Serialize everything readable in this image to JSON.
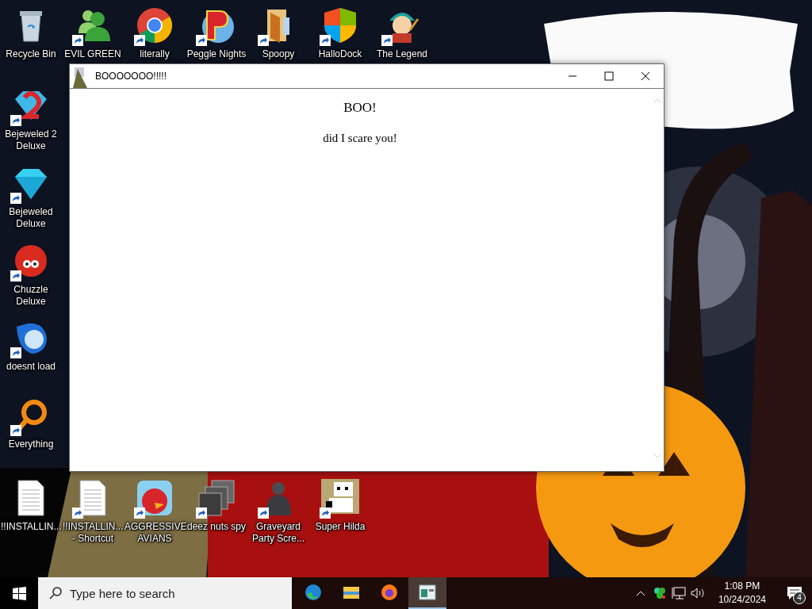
{
  "desktop": {
    "top_row": [
      {
        "label": "Recycle Bin",
        "kind": "trash",
        "shortcut": false
      },
      {
        "label": "EVIL GREEN",
        "kind": "people",
        "shortcut": true
      },
      {
        "label": "literally",
        "kind": "browser",
        "shortcut": true
      },
      {
        "label": "Peggle Nights",
        "kind": "letter-ball",
        "shortcut": true
      },
      {
        "label": "Spoopy",
        "kind": "folder",
        "shortcut": true
      },
      {
        "label": "HalloDock",
        "kind": "shield",
        "shortcut": true
      },
      {
        "label": "The Legend",
        "kind": "character",
        "shortcut": true
      }
    ],
    "left_column": [
      {
        "label": "Bejeweled 2 Deluxe",
        "kind": "gem-two",
        "shortcut": true
      },
      {
        "label": "Bejeweled Deluxe",
        "kind": "gem",
        "shortcut": true
      },
      {
        "label": "Chuzzle Deluxe",
        "kind": "fuzzball",
        "shortcut": true
      },
      {
        "label": "doesnt load",
        "kind": "blue-bird",
        "shortcut": true
      },
      {
        "label": "Everything",
        "kind": "ring",
        "shortcut": true
      }
    ],
    "bottom_row": [
      {
        "label": "!!INSTALLIN...",
        "kind": "document",
        "shortcut": false
      },
      {
        "label": "!!INSTALLIN... - Shortcut",
        "kind": "document",
        "shortcut": true
      },
      {
        "label": "AGGRESSIVE AVIANS",
        "kind": "red-bird",
        "shortcut": true
      },
      {
        "label": "deez nuts spy",
        "kind": "stack",
        "shortcut": true
      },
      {
        "label": "Graveyard Party Scre...",
        "kind": "figure",
        "shortcut": true
      },
      {
        "label": "Super Hilda",
        "kind": "pixel",
        "shortcut": true
      }
    ]
  },
  "window": {
    "title": "BOOOOOOO!!!!!",
    "heading": "BOO!",
    "text": "did I scare you!"
  },
  "taskbar": {
    "search": {
      "placeholder": "Type here to search"
    },
    "apps": [
      {
        "kind": "edge",
        "selected": false
      },
      {
        "kind": "folder",
        "selected": false
      },
      {
        "kind": "firefox",
        "selected": false
      },
      {
        "kind": "window",
        "selected": true
      }
    ],
    "time": "1:08 PM",
    "date": "10/24/2024",
    "notifications": "4"
  }
}
